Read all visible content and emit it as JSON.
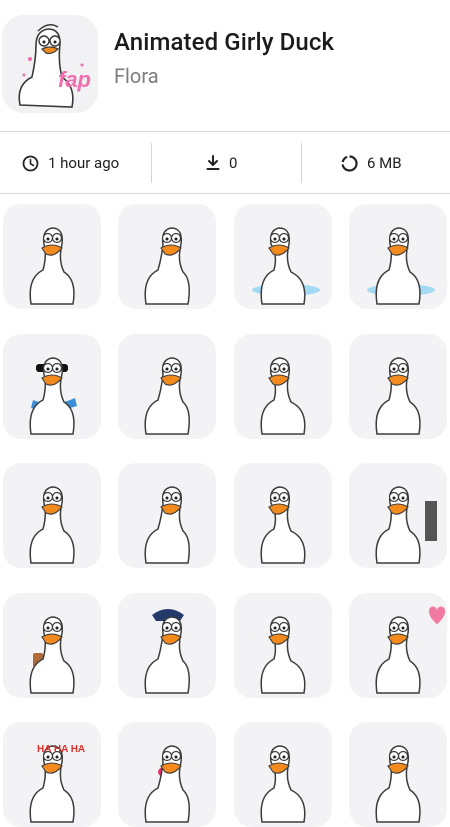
{
  "pack": {
    "title": "Animated Girly Duck",
    "author": "Flora",
    "icon": "duck-sticker",
    "icon_caption": "fap"
  },
  "stats": {
    "updated": {
      "icon": "clock-icon",
      "text": "1 hour ago"
    },
    "downloads": {
      "icon": "download-icon",
      "text": "0"
    },
    "size": {
      "icon": "storage-icon",
      "text": "6 MB"
    }
  },
  "stickers": [
    {
      "name": "sticker-duck-worried"
    },
    {
      "name": "sticker-duck-pointing"
    },
    {
      "name": "sticker-duck-floating"
    },
    {
      "name": "sticker-duck-crying"
    },
    {
      "name": "sticker-duck-sunglasses"
    },
    {
      "name": "sticker-duck-grinning"
    },
    {
      "name": "sticker-duck-waving"
    },
    {
      "name": "sticker-duck-hugging-self"
    },
    {
      "name": "sticker-duck-tangled"
    },
    {
      "name": "sticker-duck-teeth"
    },
    {
      "name": "sticker-duck-tiny"
    },
    {
      "name": "sticker-duck-computer"
    },
    {
      "name": "sticker-duck-coffee"
    },
    {
      "name": "sticker-duck-police"
    },
    {
      "name": "sticker-duck-shrug"
    },
    {
      "name": "sticker-duck-heart"
    },
    {
      "name": "sticker-duck-haha",
      "caption": "HA HA HA"
    },
    {
      "name": "sticker-duck-lipstick"
    },
    {
      "name": "sticker-duck-kiss"
    },
    {
      "name": "sticker-duck-wings-up"
    }
  ],
  "colors": {
    "beak": "#f28a1e",
    "tile_bg": "#f3f3f5",
    "text_primary": "#1b1b1b",
    "text_secondary": "#7d7d7d",
    "heart": "#f07aa0",
    "water": "#8fd3f4",
    "lips": "#e8306a"
  }
}
